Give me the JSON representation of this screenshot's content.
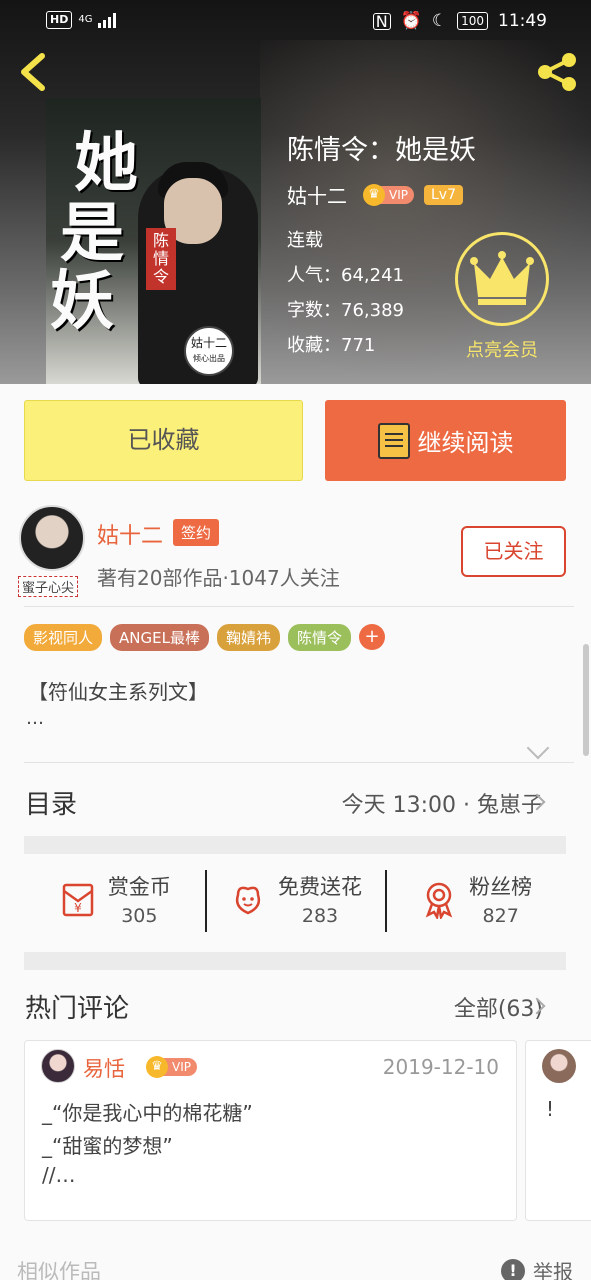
{
  "statusbar": {
    "hd": "HD",
    "network": "4G",
    "battery": "100",
    "time": "11:49"
  },
  "book": {
    "title": "陈情令：她是妖",
    "author": "姑十二",
    "vip_label": "VIP",
    "level": "Lv7",
    "status": "连载",
    "popularity": "人气：64,241",
    "word_count": "字数：76,389",
    "favorites": "收藏：771",
    "member_label": "点亮会员",
    "cover": {
      "title_chars": [
        "她",
        "是",
        "妖"
      ],
      "stamp": "陈情令",
      "seal_name": "姑十二",
      "seal_sub": "倾心出品"
    }
  },
  "actions": {
    "collect": "已收藏",
    "read": "继续阅读"
  },
  "author_info": {
    "name": "姑十二",
    "sign_badge": "签约",
    "avatar_tag": "蜜子心尖",
    "desc": "著有20部作品·1047人关注",
    "follow": "已关注"
  },
  "tags": [
    {
      "label": "影视同人",
      "color": "#f2aa3b"
    },
    {
      "label": "ANGEL最棒",
      "color": "#c97058"
    },
    {
      "label": "鞠婧祎",
      "color": "#d9a13c"
    },
    {
      "label": "陈情令",
      "color": "#9bbf5b"
    }
  ],
  "tags_add": "+",
  "intro": {
    "line1": "【符仙女主系列文】",
    "line2": "…"
  },
  "toc": {
    "title": "目录",
    "latest": "今天 13:00 · 兔崽子"
  },
  "stats": [
    {
      "label": "赏金币",
      "value": "305",
      "icon": "red-envelope-icon"
    },
    {
      "label": "免费送花",
      "value": "283",
      "icon": "flower-icon"
    },
    {
      "label": "粉丝榜",
      "value": "827",
      "icon": "medal-icon"
    }
  ],
  "comments": {
    "title": "热门评论",
    "all": "全部(63)",
    "items": [
      {
        "user": "易恬",
        "vip": "VIP",
        "date": "2019-12-10",
        "lines": [
          "_“你是我心中的棉花糖”",
          "_“甜蜜的梦想”",
          "//…"
        ]
      },
      {
        "text": "!"
      }
    ]
  },
  "footer": {
    "similar": "相似作品",
    "report": "举报",
    "report_icon": "!"
  },
  "colors": {
    "accent": "#ed6a43",
    "collect_bg": "#fbf07a",
    "member_gold": "#f8e56a"
  }
}
